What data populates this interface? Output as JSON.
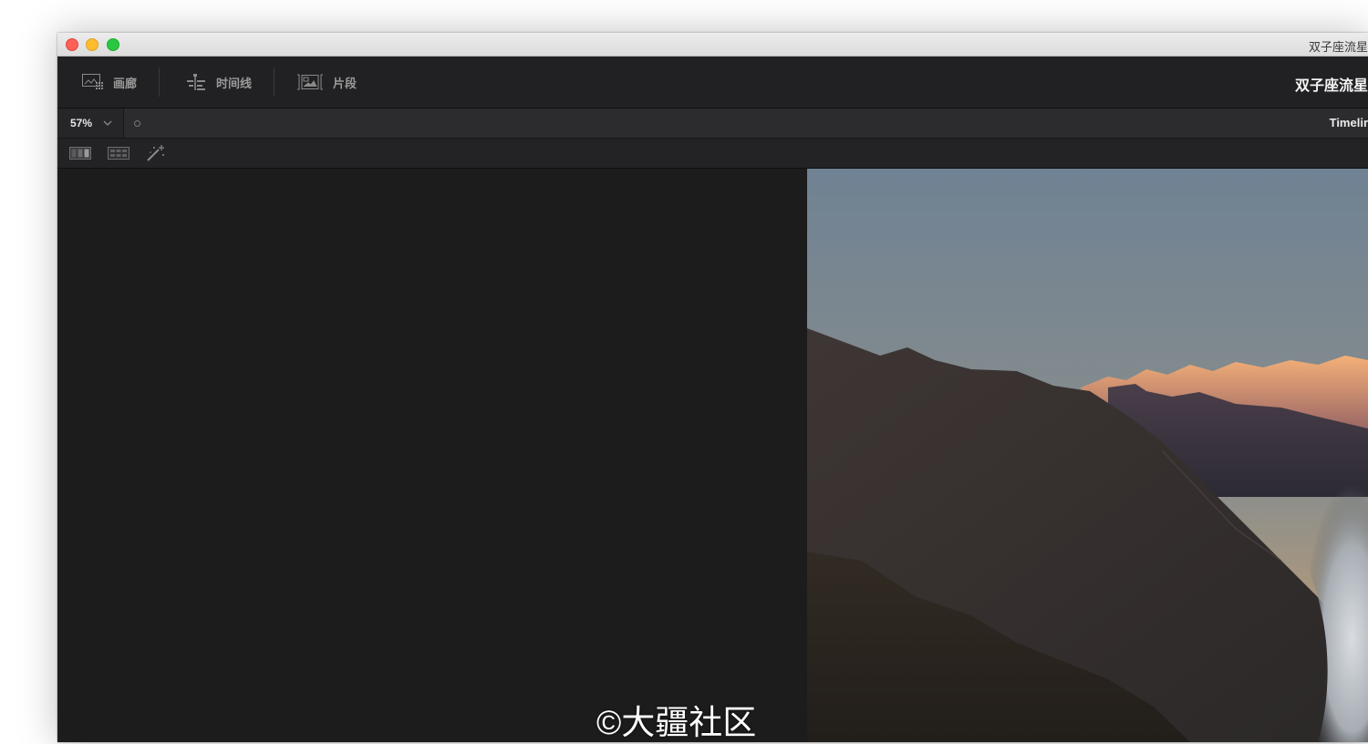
{
  "window": {
    "title": "双子座流星"
  },
  "toolbar": {
    "gallery_label": "画廊",
    "timeline_label": "时间线",
    "clips_label": "片段",
    "project_title": "双子座流星"
  },
  "viewer_bar": {
    "zoom_value": "57%",
    "timeline_name": "Timelir"
  },
  "icon_bar": {
    "icons": [
      "split-view-icon",
      "grid-view-icon",
      "magic-wand-icon"
    ]
  },
  "viewer": {
    "image": "mountain-sunset-frame"
  },
  "watermark": {
    "text": "©大疆社区"
  },
  "colors": {
    "window_bg": "#1c1c1e",
    "toolbar_bg": "#212124",
    "accent_text": "#f2f2f2",
    "close": "#fe5f57",
    "minimize": "#febc2e",
    "maximize": "#28c840"
  }
}
